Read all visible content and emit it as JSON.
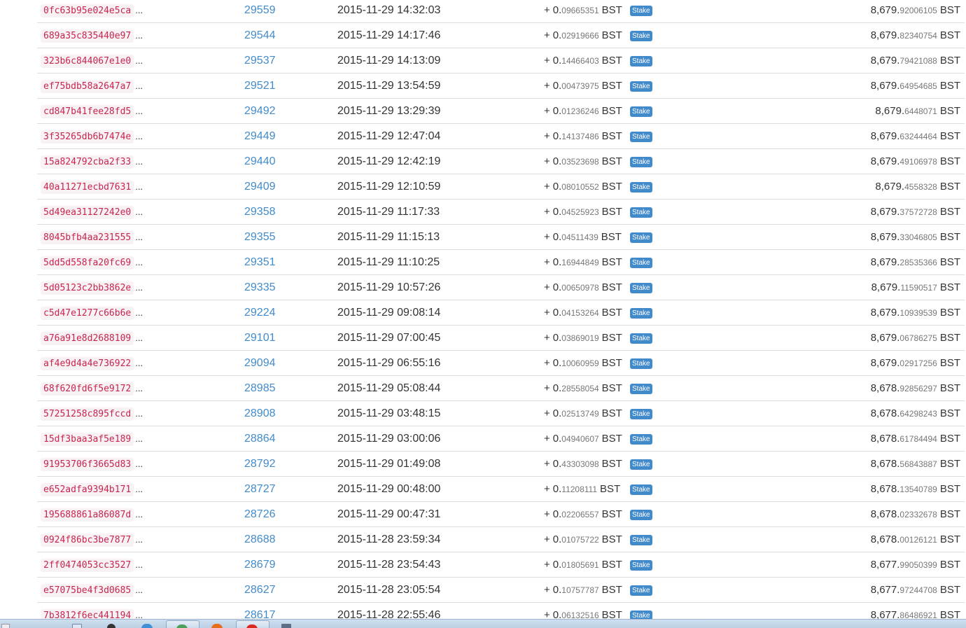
{
  "currency": "BST",
  "badge_label": "Stake",
  "rows": [
    {
      "txid": "0fc63b95e024e5ca",
      "block": "29559",
      "time": "2015-11-29 14:32:03",
      "sign": "+",
      "amount_int": "0.",
      "amount_dec": "09665351",
      "balance_int": "8,679.",
      "balance_dec": "92006105"
    },
    {
      "txid": "689a35c835440e97",
      "block": "29544",
      "time": "2015-11-29 14:17:46",
      "sign": "+",
      "amount_int": "0.",
      "amount_dec": "02919666",
      "balance_int": "8,679.",
      "balance_dec": "82340754"
    },
    {
      "txid": "323b6c844067e1e0",
      "block": "29537",
      "time": "2015-11-29 14:13:09",
      "sign": "+",
      "amount_int": "0.",
      "amount_dec": "14466403",
      "balance_int": "8,679.",
      "balance_dec": "79421088"
    },
    {
      "txid": "ef75bdb58a2647a7",
      "block": "29521",
      "time": "2015-11-29 13:54:59",
      "sign": "+",
      "amount_int": "0.",
      "amount_dec": "00473975",
      "balance_int": "8,679.",
      "balance_dec": "64954685"
    },
    {
      "txid": "cd847b41fee28fd5",
      "block": "29492",
      "time": "2015-11-29 13:29:39",
      "sign": "+",
      "amount_int": "0.",
      "amount_dec": "01236246",
      "balance_int": "8,679.",
      "balance_dec": "6448071"
    },
    {
      "txid": "3f35265db6b7474e",
      "block": "29449",
      "time": "2015-11-29 12:47:04",
      "sign": "+",
      "amount_int": "0.",
      "amount_dec": "14137486",
      "balance_int": "8,679.",
      "balance_dec": "63244464"
    },
    {
      "txid": "15a824792cba2f33",
      "block": "29440",
      "time": "2015-11-29 12:42:19",
      "sign": "+",
      "amount_int": "0.",
      "amount_dec": "03523698",
      "balance_int": "8,679.",
      "balance_dec": "49106978"
    },
    {
      "txid": "40a11271ecbd7631",
      "block": "29409",
      "time": "2015-11-29 12:10:59",
      "sign": "+",
      "amount_int": "0.",
      "amount_dec": "08010552",
      "balance_int": "8,679.",
      "balance_dec": "4558328"
    },
    {
      "txid": "5d49ea31127242e0",
      "block": "29358",
      "time": "2015-11-29 11:17:33",
      "sign": "+",
      "amount_int": "0.",
      "amount_dec": "04525923",
      "balance_int": "8,679.",
      "balance_dec": "37572728"
    },
    {
      "txid": "8045bfb4aa231555",
      "block": "29355",
      "time": "2015-11-29 11:15:13",
      "sign": "+",
      "amount_int": "0.",
      "amount_dec": "04511439",
      "balance_int": "8,679.",
      "balance_dec": "33046805"
    },
    {
      "txid": "5dd5d558fa20fc69",
      "block": "29351",
      "time": "2015-11-29 11:10:25",
      "sign": "+",
      "amount_int": "0.",
      "amount_dec": "16944849",
      "balance_int": "8,679.",
      "balance_dec": "28535366"
    },
    {
      "txid": "5d05123c2bb3862e",
      "block": "29335",
      "time": "2015-11-29 10:57:26",
      "sign": "+",
      "amount_int": "0.",
      "amount_dec": "00650978",
      "balance_int": "8,679.",
      "balance_dec": "11590517"
    },
    {
      "txid": "c5d47e1277c66b6e",
      "block": "29224",
      "time": "2015-11-29 09:08:14",
      "sign": "+",
      "amount_int": "0.",
      "amount_dec": "04153264",
      "balance_int": "8,679.",
      "balance_dec": "10939539"
    },
    {
      "txid": "a76a91e8d2688109",
      "block": "29101",
      "time": "2015-11-29 07:00:45",
      "sign": "+",
      "amount_int": "0.",
      "amount_dec": "03869019",
      "balance_int": "8,679.",
      "balance_dec": "06786275"
    },
    {
      "txid": "af4e9d4a4e736922",
      "block": "29094",
      "time": "2015-11-29 06:55:16",
      "sign": "+",
      "amount_int": "0.",
      "amount_dec": "10060959",
      "balance_int": "8,679.",
      "balance_dec": "02917256"
    },
    {
      "txid": "68f620fd6f5e9172",
      "block": "28985",
      "time": "2015-11-29 05:08:44",
      "sign": "+",
      "amount_int": "0.",
      "amount_dec": "28558054",
      "balance_int": "8,678.",
      "balance_dec": "92856297"
    },
    {
      "txid": "57251258c895fccd",
      "block": "28908",
      "time": "2015-11-29 03:48:15",
      "sign": "+",
      "amount_int": "0.",
      "amount_dec": "02513749",
      "balance_int": "8,678.",
      "balance_dec": "64298243"
    },
    {
      "txid": "15df3baa3af5e189",
      "block": "28864",
      "time": "2015-11-29 03:00:06",
      "sign": "+",
      "amount_int": "0.",
      "amount_dec": "04940607",
      "balance_int": "8,678.",
      "balance_dec": "61784494"
    },
    {
      "txid": "91953706f3665d83",
      "block": "28792",
      "time": "2015-11-29 01:49:08",
      "sign": "+",
      "amount_int": "0.",
      "amount_dec": "43303098",
      "balance_int": "8,678.",
      "balance_dec": "56843887"
    },
    {
      "txid": "e652adfa9394b171",
      "block": "28727",
      "time": "2015-11-29 00:48:00",
      "sign": "+",
      "amount_int": "0.",
      "amount_dec": "11208111",
      "balance_int": "8,678.",
      "balance_dec": "13540789"
    },
    {
      "txid": "195688861a86087d",
      "block": "28726",
      "time": "2015-11-29 00:47:31",
      "sign": "+",
      "amount_int": "0.",
      "amount_dec": "02206557",
      "balance_int": "8,678.",
      "balance_dec": "02332678"
    },
    {
      "txid": "0924f86bc3be7877",
      "block": "28688",
      "time": "2015-11-28 23:59:34",
      "sign": "+",
      "amount_int": "0.",
      "amount_dec": "01075722",
      "balance_int": "8,678.",
      "balance_dec": "00126121"
    },
    {
      "txid": "2ff0474053cc3527",
      "block": "28679",
      "time": "2015-11-28 23:54:43",
      "sign": "+",
      "amount_int": "0.",
      "amount_dec": "01805691",
      "balance_int": "8,677.",
      "balance_dec": "99050399"
    },
    {
      "txid": "e57075be4f3d0685",
      "block": "28627",
      "time": "2015-11-28 23:05:54",
      "sign": "+",
      "amount_int": "0.",
      "amount_dec": "10757787",
      "balance_int": "8,677.",
      "balance_dec": "97244708"
    },
    {
      "txid": "7b3812f6ec441194",
      "block": "28617",
      "time": "2015-11-28 22:55:46",
      "sign": "+",
      "amount_int": "0.",
      "amount_dec": "06132516",
      "balance_int": "8,677.",
      "balance_dec": "86486921"
    }
  ],
  "taskbar": {
    "icons": [
      "start-icon",
      "explorer-icon",
      "media-icon",
      "ie-icon",
      "chrome-icon",
      "firefox-icon",
      "opera-icon",
      "calculator-icon"
    ]
  }
}
